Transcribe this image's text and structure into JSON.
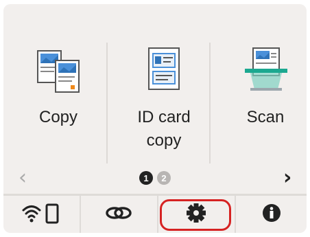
{
  "tiles": [
    {
      "label": "Copy",
      "icon": "copy-icon"
    },
    {
      "label": "ID card\ncopy",
      "icon": "id-card-copy-icon"
    },
    {
      "label": "Scan",
      "icon": "scan-icon"
    }
  ],
  "nav": {
    "prev": "‹",
    "next": "›"
  },
  "pages": {
    "current": "1",
    "other": "2"
  },
  "bottom": {
    "wireless": "wifi-phone-icon",
    "connect": "link-icon",
    "settings": "gear-icon",
    "info": "info-icon"
  },
  "colors": {
    "highlight": "#d62222",
    "accent_blue": "#2f73b8",
    "accent_green": "#1ca890"
  }
}
